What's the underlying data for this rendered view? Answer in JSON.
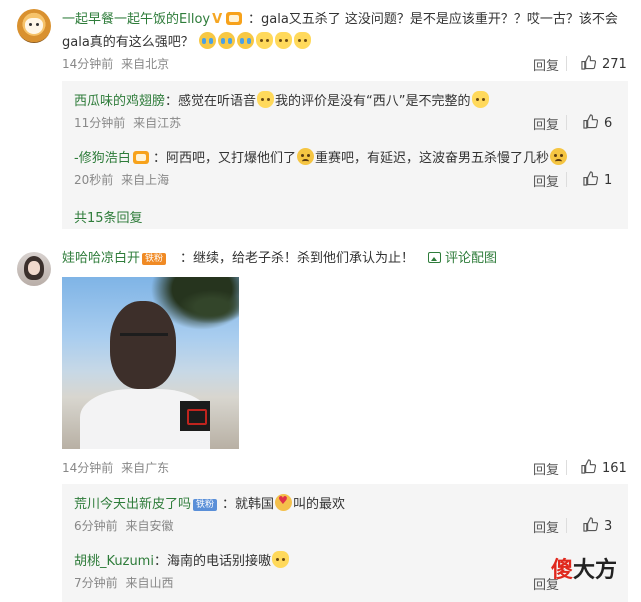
{
  "comments": [
    {
      "username": "一起早餐一起午饭的Elloy",
      "text_a": "：gala又五杀了 这没问题？是不是应该重开？？哎一古？该不会",
      "text_b": "gala真的有这么强吧？",
      "time": "14分钟前",
      "source": "来自北京",
      "reply_label": "回复",
      "likes": "271",
      "replies": [
        {
          "username": "西瓜味的鸡翅膀",
          "text_a": "：感觉在听语音",
          "text_b": "我的评价是没有“西八”是不完整的",
          "time": "11分钟前",
          "source": "来自江苏",
          "reply_label": "回复",
          "likes": "6"
        },
        {
          "username": "-修狗浩白",
          "text_a": "：阿西吧，又打爆他们了",
          "text_b": "重赛吧，有延迟，这波奋男五杀慢了几秒",
          "time": "20秒前",
          "source": "来自上海",
          "reply_label": "回复",
          "likes": "1"
        }
      ],
      "total_replies": "共15条回复"
    },
    {
      "username": "娃哈哈凉白开",
      "fan_badge": "铁粉",
      "text": "：继续，给老子杀！杀到他们承认为止！",
      "image_link": "评论配图",
      "time": "14分钟前",
      "source": "来自广东",
      "reply_label": "回复",
      "likes": "161",
      "replies": [
        {
          "username": "荒川今天出新皮了吗",
          "fan_badge": "铁粉",
          "text_a": "：就韩国",
          "text_b": "叫的最欢",
          "time": "6分钟前",
          "source": "来自安徽",
          "reply_label": "回复",
          "likes": "3"
        },
        {
          "username": "胡桃_Kuzumi",
          "text_a": "：海南的电话别接嗷",
          "time": "7分钟前",
          "source": "来自山西",
          "reply_label": "回复"
        }
      ]
    }
  ],
  "watermark": {
    "part_a": "傻",
    "part_b": "大方"
  },
  "icons": [
    "thumb-up-icon",
    "image-icon",
    "crown-icon",
    "verified-v-icon",
    "emoji-icon"
  ],
  "colors": {
    "username": "#2e7c3a",
    "reply_bg": "#f5f5f5",
    "badge": "#f08a24"
  }
}
